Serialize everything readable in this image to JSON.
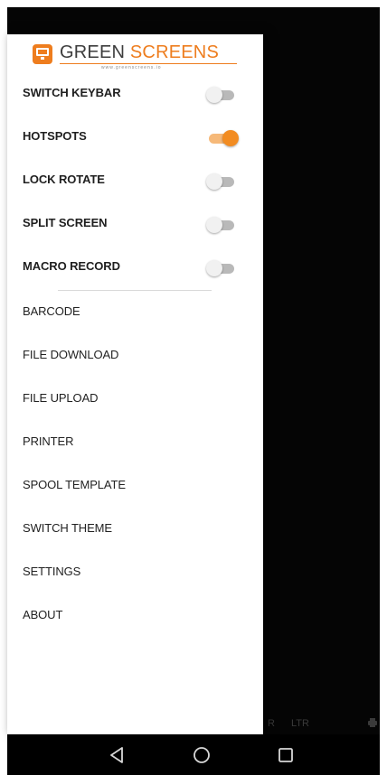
{
  "logo": {
    "part1": "GREEN",
    "part2": "SCREENS",
    "subtitle": "www.greenscreens.io",
    "brand_color": "#ee7d1e"
  },
  "toggles": [
    {
      "label": "SWITCH KEYBAR",
      "on": false
    },
    {
      "label": "HOTSPOTS",
      "on": true
    },
    {
      "label": "LOCK ROTATE",
      "on": false
    },
    {
      "label": "SPLIT SCREEN",
      "on": false
    },
    {
      "label": "MACRO RECORD",
      "on": false
    }
  ],
  "menu": [
    {
      "label": "BARCODE"
    },
    {
      "label": "FILE DOWNLOAD"
    },
    {
      "label": "FILE UPLOAD"
    },
    {
      "label": "PRINTER"
    },
    {
      "label": "SPOOL TEMPLATE"
    },
    {
      "label": "SWITCH THEME"
    },
    {
      "label": "SETTINGS"
    },
    {
      "label": "ABOUT"
    }
  ],
  "background_bar": {
    "partial_text": "R",
    "ltr_label": "LTR",
    "print_icon": "printer-icon"
  },
  "navigation_bar": {
    "back_icon": "back-triangle-icon",
    "home_icon": "home-circle-icon",
    "recents_icon": "recents-square-icon"
  }
}
